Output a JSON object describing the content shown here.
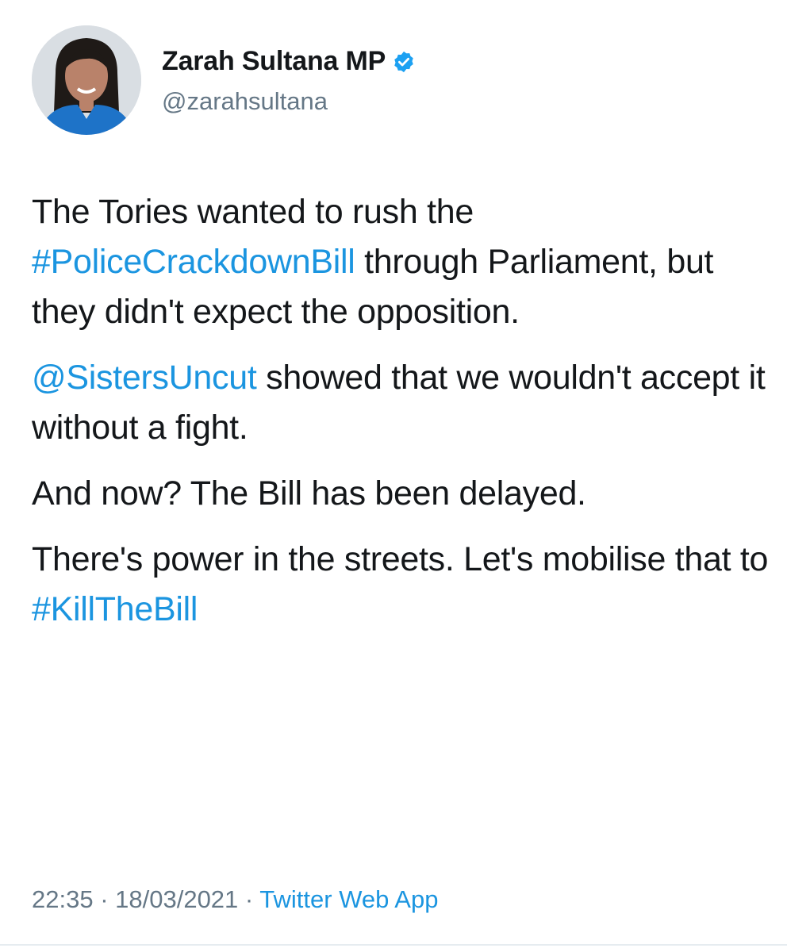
{
  "author": {
    "display_name": "Zarah Sultana MP",
    "handle": "@zarahsultana",
    "verified": true
  },
  "tweet": {
    "p1_a": "The Tories wanted to rush the ",
    "p1_hashtag": "#PoliceCrackdownBill",
    "p1_b": " through Parliament, but they didn't expect the opposition.",
    "p2_mention": "@SistersUncut",
    "p2_b": " showed that we wouldn't accept it without a fight.",
    "p3": "And now? The Bill has been delayed.",
    "p4_a": "There's power in the streets. Let's mobilise that to ",
    "p4_hashtag": "#KillTheBill"
  },
  "meta": {
    "time": "22:35",
    "sep1": " · ",
    "date": "18/03/2021",
    "sep2": " · ",
    "source": "Twitter Web App"
  },
  "colors": {
    "link": "#1b95e0",
    "text": "#14171a",
    "muted": "#657786",
    "verified": "#1da1f2"
  }
}
